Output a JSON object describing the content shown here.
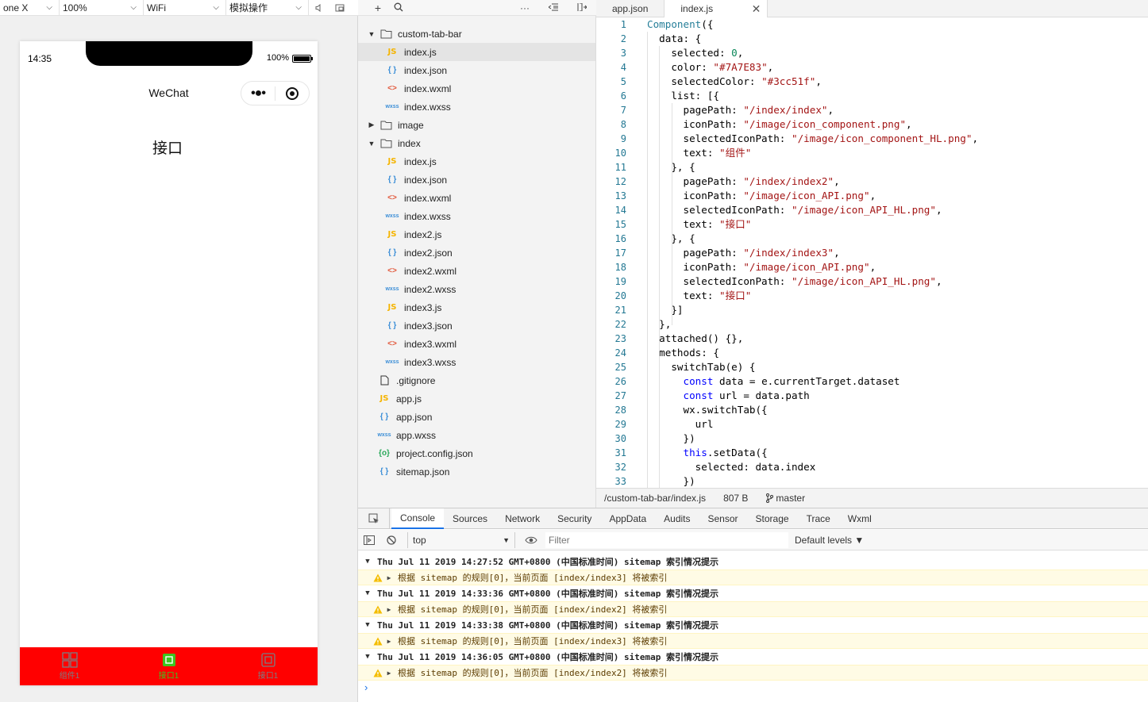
{
  "simulator": {
    "toolbar": {
      "device": "one X",
      "zoom": "100%",
      "network": "WiFi",
      "ops": "模拟操作"
    },
    "status": {
      "time": "14:35",
      "battery": "100%"
    },
    "nav_title": "WeChat",
    "page_heading": "接口",
    "tabbar": {
      "color": "#7A7E83",
      "selected_color": "#3cc51f",
      "background": "#ff0000",
      "items": [
        {
          "label": "组件1",
          "icon": "grid-icon"
        },
        {
          "label": "接口1",
          "icon": "api-icon"
        },
        {
          "label": "接口1",
          "icon": "api-icon"
        }
      ]
    }
  },
  "explorer": {
    "toolbar_icons": [
      "plus-icon",
      "search-icon",
      "more-icon",
      "outdent-icon",
      "split-icon"
    ],
    "tree": [
      {
        "label": "custom-tab-bar",
        "type": "folder",
        "level": 0,
        "open": true
      },
      {
        "label": "index.js",
        "type": "js",
        "level": 1,
        "active": true
      },
      {
        "label": "index.json",
        "type": "json",
        "level": 1
      },
      {
        "label": "index.wxml",
        "type": "wxml",
        "level": 1
      },
      {
        "label": "index.wxss",
        "type": "wxss",
        "level": 1
      },
      {
        "label": "image",
        "type": "folder",
        "level": 0,
        "open": false
      },
      {
        "label": "index",
        "type": "folder",
        "level": 0,
        "open": true
      },
      {
        "label": "index.js",
        "type": "js",
        "level": 1
      },
      {
        "label": "index.json",
        "type": "json",
        "level": 1
      },
      {
        "label": "index.wxml",
        "type": "wxml",
        "level": 1
      },
      {
        "label": "index.wxss",
        "type": "wxss",
        "level": 1
      },
      {
        "label": "index2.js",
        "type": "js",
        "level": 1
      },
      {
        "label": "index2.json",
        "type": "json",
        "level": 1
      },
      {
        "label": "index2.wxml",
        "type": "wxml",
        "level": 1
      },
      {
        "label": "index2.wxss",
        "type": "wxss",
        "level": 1
      },
      {
        "label": "index3.js",
        "type": "js",
        "level": 1
      },
      {
        "label": "index3.json",
        "type": "json",
        "level": 1
      },
      {
        "label": "index3.wxml",
        "type": "wxml",
        "level": 1
      },
      {
        "label": "index3.wxss",
        "type": "wxss",
        "level": 1
      },
      {
        "label": ".gitignore",
        "type": "file",
        "level": 0
      },
      {
        "label": "app.js",
        "type": "js",
        "level": 0
      },
      {
        "label": "app.json",
        "type": "json",
        "level": 0
      },
      {
        "label": "app.wxss",
        "type": "wxss",
        "level": 0
      },
      {
        "label": "project.config.json",
        "type": "cfg",
        "level": 0
      },
      {
        "label": "sitemap.json",
        "type": "json",
        "level": 0
      }
    ],
    "icon_glyphs": {
      "js": "JS",
      "json": "{ }",
      "wxml": "<>",
      "wxss": "wxss",
      "cfg": "{o}"
    }
  },
  "editor": {
    "tabs": [
      {
        "label": "app.json"
      },
      {
        "label": "index.js",
        "active": true
      }
    ],
    "lines": [
      "Component({",
      "  data: {",
      "    selected: 0,",
      "    color: \"#7A7E83\",",
      "    selectedColor: \"#3cc51f\",",
      "    list: [{",
      "      pagePath: \"/index/index\",",
      "      iconPath: \"/image/icon_component.png\",",
      "      selectedIconPath: \"/image/icon_component_HL.png\",",
      "      text: \"组件\"",
      "    }, {",
      "      pagePath: \"/index/index2\",",
      "      iconPath: \"/image/icon_API.png\",",
      "      selectedIconPath: \"/image/icon_API_HL.png\",",
      "      text: \"接口\"",
      "    }, {",
      "      pagePath: \"/index/index3\",",
      "      iconPath: \"/image/icon_API.png\",",
      "      selectedIconPath: \"/image/icon_API_HL.png\",",
      "      text: \"接口\"",
      "    }]",
      "  },",
      "  attached() {},",
      "  methods: {",
      "    switchTab(e) {",
      "      const data = e.currentTarget.dataset",
      "      const url = data.path",
      "      wx.switchTab({",
      "        url",
      "      })",
      "      this.setData({",
      "        selected: data.index",
      "      })"
    ],
    "status": {
      "path": "/custom-tab-bar/index.js",
      "size": "807 B",
      "branch": "master"
    }
  },
  "devtools": {
    "tabs": [
      "Console",
      "Sources",
      "Network",
      "Security",
      "AppData",
      "Audits",
      "Sensor",
      "Storage",
      "Trace",
      "Wxml"
    ],
    "active_tab": "Console",
    "context": "top",
    "filter_placeholder": "Filter",
    "levels": "Default levels ▼",
    "logs": [
      {
        "head": "Thu Jul 11 2019 14:27:52 GMT+0800 (中国标准时间) sitemap 索引情况提示",
        "warn": "根据 sitemap 的规则[0]，当前页面 [index/index3] 将被索引"
      },
      {
        "head": "Thu Jul 11 2019 14:33:36 GMT+0800 (中国标准时间) sitemap 索引情况提示",
        "warn": "根据 sitemap 的规则[0]，当前页面 [index/index2] 将被索引"
      },
      {
        "head": "Thu Jul 11 2019 14:33:38 GMT+0800 (中国标准时间) sitemap 索引情况提示",
        "warn": "根据 sitemap 的规则[0]，当前页面 [index/index3] 将被索引"
      },
      {
        "head": "Thu Jul 11 2019 14:36:05 GMT+0800 (中国标准时间) sitemap 索引情况提示",
        "warn": "根据 sitemap 的规则[0]，当前页面 [index/index2] 将被索引"
      }
    ],
    "prompt": "›"
  }
}
